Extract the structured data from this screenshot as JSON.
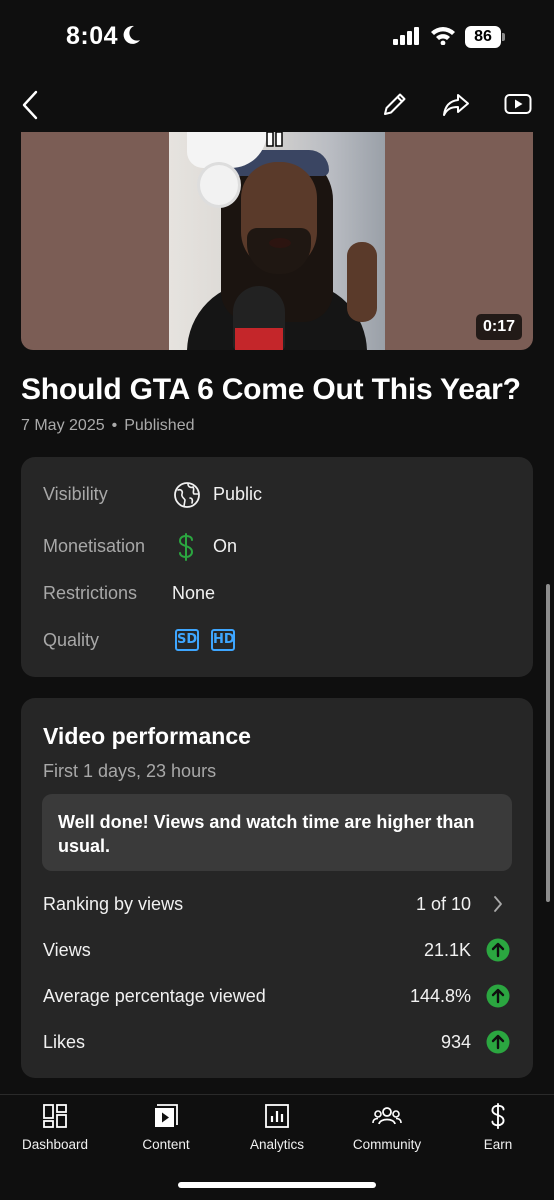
{
  "status_bar": {
    "time": "8:04",
    "battery": "86"
  },
  "app_bar": {
    "back_icon": "back-arrow-icon",
    "edit_icon": "pencil-icon",
    "share_icon": "share-icon",
    "youtube_icon": "youtube-icon"
  },
  "video": {
    "duration": "0:17"
  },
  "title": "Should GTA 6 Come Out This Year?",
  "meta": {
    "date": "7 May 2025",
    "separator": "•",
    "status": "Published"
  },
  "details": {
    "visibility_label": "Visibility",
    "visibility_value": "Public",
    "monetisation_label": "Monetisation",
    "monetisation_value": "On",
    "restrictions_label": "Restrictions",
    "restrictions_value": "None",
    "quality_label": "Quality",
    "quality_badges": [
      "SD",
      "HD"
    ],
    "colors": {
      "monetisation": "#2ba640",
      "quality": "#3ea6ff"
    }
  },
  "performance": {
    "title": "Video performance",
    "subtitle": "First 1 days, 23 hours",
    "banner": "Well done! Views and watch time are higher than usual.",
    "rows": [
      {
        "label": "Ranking by views",
        "value": "1 of 10",
        "indicator": "chevron-right-icon"
      },
      {
        "label": "Views",
        "value": "21.1K",
        "indicator": "arrow-up-icon"
      },
      {
        "label": "Average percentage viewed",
        "value": "144.8%",
        "indicator": "arrow-up-icon"
      },
      {
        "label": "Likes",
        "value": "934",
        "indicator": "arrow-up-icon"
      }
    ],
    "up_color": "#2ba640"
  },
  "bottom_nav": [
    {
      "label": "Dashboard",
      "icon": "dashboard-icon"
    },
    {
      "label": "Content",
      "icon": "content-icon"
    },
    {
      "label": "Analytics",
      "icon": "analytics-icon"
    },
    {
      "label": "Community",
      "icon": "community-icon"
    },
    {
      "label": "Earn",
      "icon": "dollar-icon"
    }
  ]
}
